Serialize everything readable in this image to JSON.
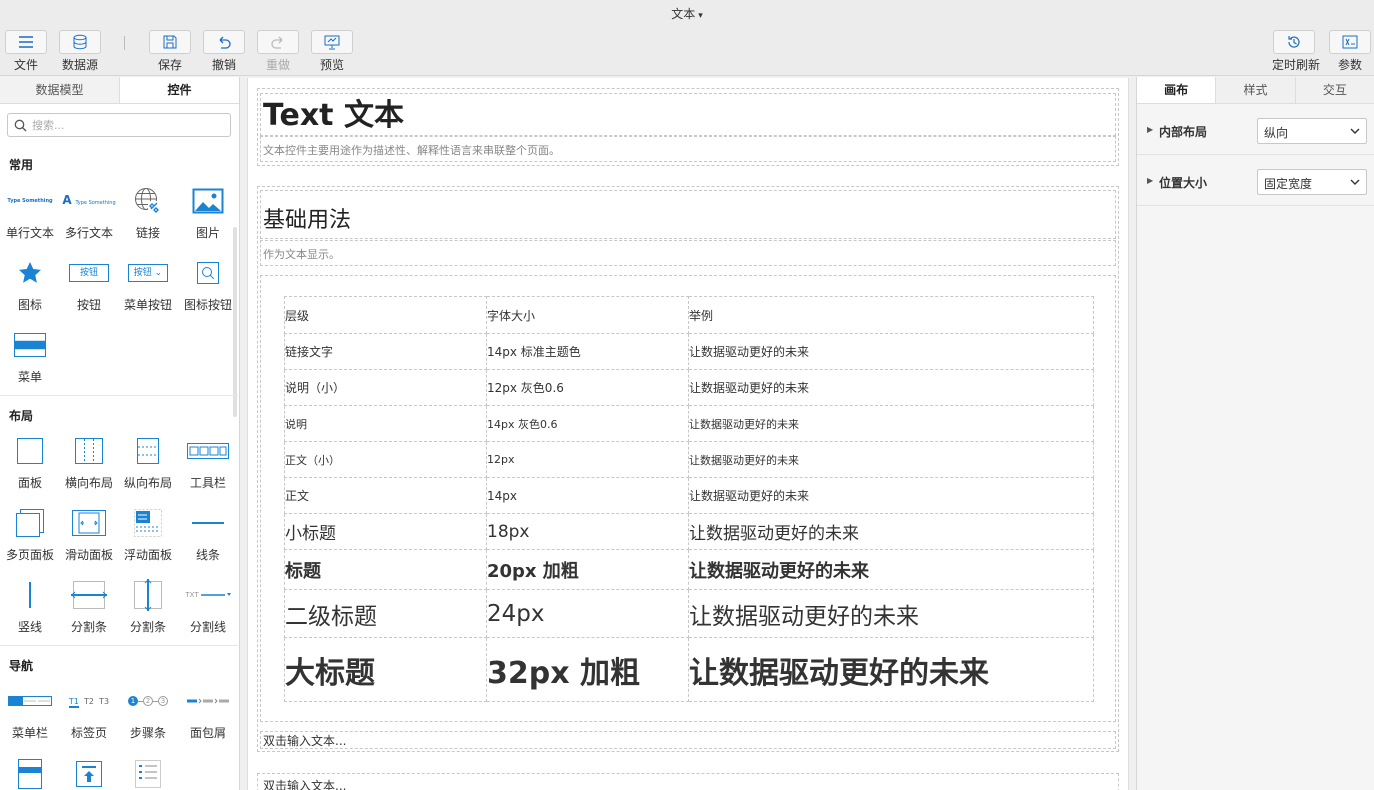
{
  "window": {
    "title": "文本"
  },
  "toolbar": {
    "file": "文件",
    "datasource": "数据源",
    "save": "保存",
    "undo": "撤销",
    "redo": "重做",
    "preview": "预览",
    "timed_refresh": "定时刷新",
    "params": "参数"
  },
  "left_panel": {
    "tabs": [
      "数据模型",
      "控件"
    ],
    "active_tab": "控件",
    "search_placeholder": "搜索...",
    "sections": [
      {
        "title": "常用",
        "items": [
          "单行文本",
          "多行文本",
          "链接",
          "图片",
          "图标",
          "按钮",
          "菜单按钮",
          "图标按钮",
          "菜单"
        ]
      },
      {
        "title": "布局",
        "items": [
          "面板",
          "横向布局",
          "纵向布局",
          "工具栏",
          "多页面板",
          "滑动面板",
          "浮动面板",
          "线条",
          "竖线",
          "分割条",
          "分割条",
          "分割线"
        ]
      },
      {
        "title": "导航",
        "items": [
          "菜单栏",
          "标签页",
          "步骤条",
          "面包屑"
        ]
      }
    ],
    "icon_texts": {
      "button": "按钮",
      "menu_button": "按钮",
      "single_text": "Type Something",
      "multi_text": "Type Something",
      "divider_txt": "TXT",
      "steps": [
        "1",
        "2",
        "3"
      ],
      "tabs": [
        "T1",
        "T2",
        "T3"
      ]
    }
  },
  "canvas": {
    "main_title": "Text 文本",
    "main_desc": "文本控件主要用途作为描述性、解释性语言来串联整个页面。",
    "section_title": "基础用法",
    "section_desc": "作为文本显示。",
    "table": {
      "headers": [
        "层级",
        "字体大小",
        "举例"
      ],
      "rows": [
        [
          "链接文字",
          "14px 标准主题色",
          "让数据驱动更好的未来"
        ],
        [
          "说明（小）",
          "12px 灰色0.6",
          "让数据驱动更好的未来"
        ],
        [
          "说明",
          "14px 灰色0.6",
          "让数据驱动更好的未来"
        ],
        [
          "正文（小）",
          "12px",
          "让数据驱动更好的未来"
        ],
        [
          "正文",
          "14px",
          "让数据驱动更好的未来"
        ],
        [
          "小标题",
          "18px",
          "让数据驱动更好的未来"
        ],
        [
          "标题",
          "20px 加粗",
          "让数据驱动更好的未来"
        ],
        [
          "二级标题",
          "24px",
          "让数据驱动更好的未来"
        ],
        [
          "大标题",
          "32px 加粗",
          "让数据驱动更好的未来"
        ]
      ]
    },
    "placeholder_1": "双击输入文本...",
    "placeholder_2": "双击输入文本..."
  },
  "right_panel": {
    "tabs": [
      "画布",
      "样式",
      "交互"
    ],
    "active_tab": "画布",
    "props": [
      {
        "label": "内部布局",
        "value": "纵向"
      },
      {
        "label": "位置大小",
        "value": "固定宽度"
      }
    ]
  },
  "colors": {
    "accent": "#1a83d4",
    "link": "#1a83d4"
  }
}
